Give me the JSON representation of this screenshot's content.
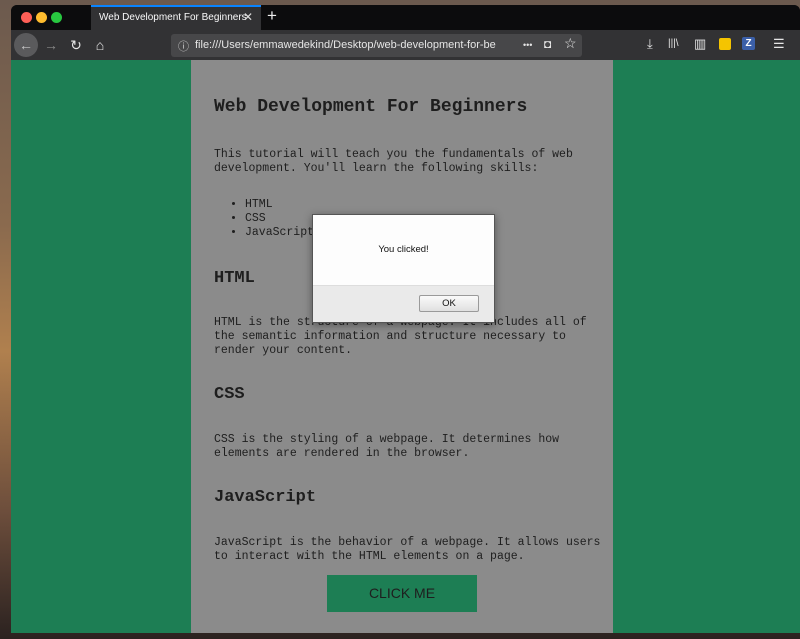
{
  "browser": {
    "tab_title": "Web Development For Beginners",
    "tab_close": "✕",
    "new_tab": "+",
    "url": "file:///Users/emmawedekind/Desktop/web-development-for-be",
    "back_glyph": "←",
    "forward_glyph": "→",
    "reload_glyph": "↻",
    "home_glyph": "⌂",
    "info_glyph": "ⓘ",
    "more_glyph": "•••",
    "pocket_glyph": "◘",
    "star_glyph": "☆",
    "download_glyph": "⤓",
    "library_glyph": "|||\\",
    "sidebar_glyph": "▥",
    "ext_z": "Z",
    "menu_glyph": "☰",
    "colors": {
      "accent": "#0a84ff",
      "page_bg": "#1d7e54"
    }
  },
  "page": {
    "title": "Web Development For Beginners",
    "intro": "This tutorial will teach you the fundamentals of web development. You'll learn the following skills:",
    "skills": [
      "HTML",
      "CSS",
      "JavaScript"
    ],
    "sections": [
      {
        "heading": "HTML",
        "text": "HTML is the structure of a webpage. It includes all of the semantic information and structure necessary to render your content."
      },
      {
        "heading": "CSS",
        "text": "CSS is the styling of a webpage. It determines how elements are rendered in the browser."
      },
      {
        "heading": "JavaScript",
        "text": "JavaScript is the behavior of a webpage. It allows users to interact with the HTML elements on a page."
      }
    ],
    "button_label": "CLICK ME"
  },
  "dialog": {
    "message": "You clicked!",
    "ok_label": "OK"
  }
}
